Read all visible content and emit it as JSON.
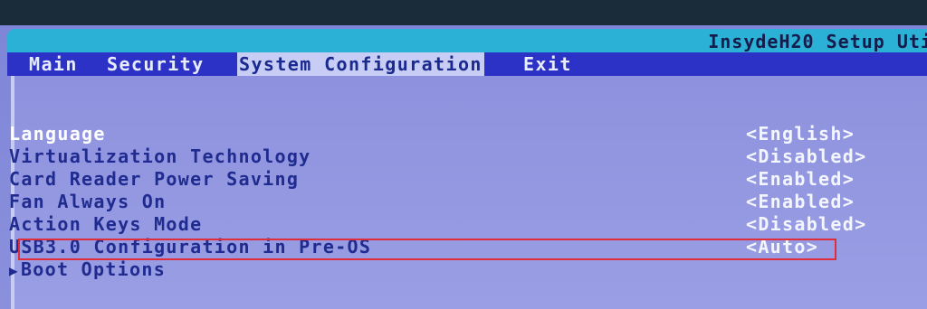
{
  "header": {
    "title": "InsydeH20 Setup Uti"
  },
  "menu": {
    "items": [
      {
        "label": "Main",
        "active": false
      },
      {
        "label": "Security",
        "active": false
      },
      {
        "label": "System Configuration",
        "active": true
      },
      {
        "label": "Exit",
        "active": false
      }
    ]
  },
  "settings": {
    "rows": [
      {
        "label": "Language",
        "value": "<English>"
      },
      {
        "label": "Virtualization Technology",
        "value": "<Disabled>"
      },
      {
        "label": "Card Reader Power Saving",
        "value": "<Enabled>"
      },
      {
        "label": "Fan Always On",
        "value": "<Enabled>"
      },
      {
        "label": "Action Keys Mode",
        "value": "<Disabled>"
      },
      {
        "label": "USB3.0 Configuration in Pre-OS",
        "value": "<Auto>"
      }
    ],
    "submenu": {
      "arrow": "▶",
      "label": "Boot Options"
    }
  },
  "colors": {
    "title_bar": "#2bb0d6",
    "menu_bar": "#2d32c7",
    "panel": "#8e92de",
    "highlight_box": "#e02d3a"
  }
}
